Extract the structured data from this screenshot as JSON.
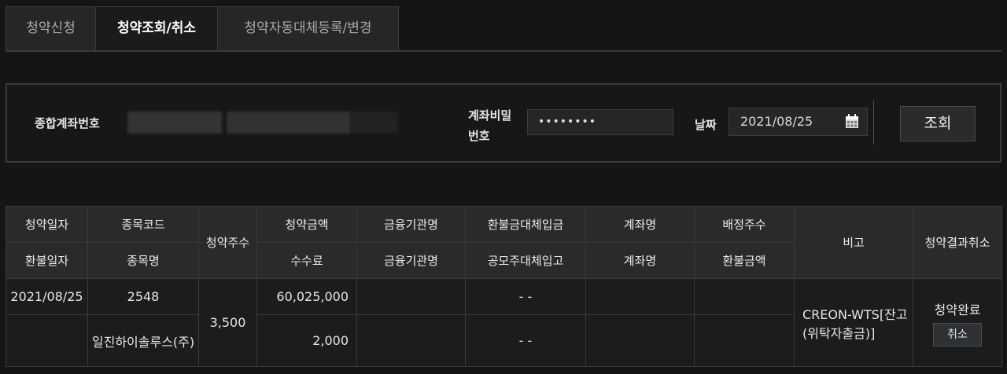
{
  "tabs": [
    {
      "label": "청약신청",
      "active": false
    },
    {
      "label": "청약조회/취소",
      "active": true
    },
    {
      "label": "청약자동대체등록/변경",
      "active": false
    }
  ],
  "search": {
    "account_label": "종합계좌번호",
    "password_label": "계좌비밀번호",
    "password_label_line1": "계좌비밀",
    "password_label_line2": "번호",
    "password_value": "••••••••",
    "date_label": "날짜",
    "date_value": "2021/08/25",
    "date_icon": "calendar-icon",
    "search_button": "조회"
  },
  "table": {
    "headers_row1": [
      "청약일자",
      "종목코드",
      "청약주수",
      "청약금액",
      "금융기관명",
      "환불금대체입금",
      "계좌명",
      "배정주수",
      "비고",
      "청약결과취소"
    ],
    "headers_row2": [
      "환불일자",
      "종목명",
      "수수료",
      "금융기관명",
      "공모주대체입고",
      "계좌명",
      "환불금액"
    ],
    "rows": [
      {
        "subscription_date": "2021/08/25",
        "stock_code": "2548",
        "subscription_qty": "3,500",
        "subscription_amount": "60,025,000",
        "institution": "",
        "refund_transfer": "- -",
        "account_name": "",
        "allocated_qty": "",
        "remark": "CREON-WTS[잔고(위탁자출금)]",
        "status": "청약완료",
        "cancel_label": "취소",
        "refund_date": "",
        "stock_name": "일진하이솔루스(주)",
        "fee": "2,000",
        "institution2": "",
        "ipo_transfer": "- -",
        "account_name2": "",
        "refund_amount": ""
      }
    ]
  },
  "colors": {
    "background": "#151515",
    "header_bg": "#2a2a2a",
    "border": "#3a3a3a",
    "active_tab_text": "#ffffff"
  }
}
